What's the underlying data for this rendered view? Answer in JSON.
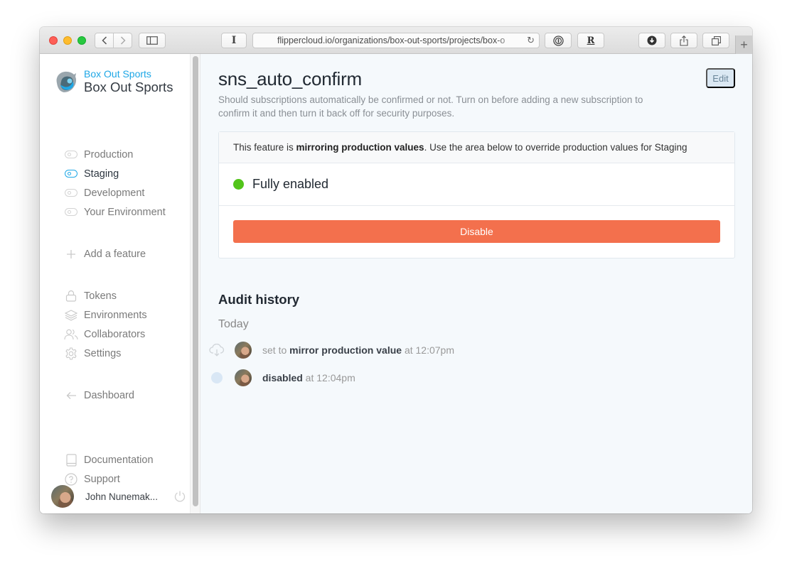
{
  "browser": {
    "url": "flippercloud.io/organizations/box-out-sports/projects/box-o",
    "reader_label": "I",
    "password_label": "①",
    "r_label": "R",
    "new_tab_label": "+"
  },
  "sidebar": {
    "brand": {
      "organization": "Box Out Sports",
      "project": "Box Out Sports"
    },
    "environments": [
      {
        "label": "Production",
        "active": false
      },
      {
        "label": "Staging",
        "active": true
      },
      {
        "label": "Development",
        "active": false
      },
      {
        "label": "Your Environment",
        "active": false
      }
    ],
    "add_feature_label": "Add a feature",
    "admin_items": [
      {
        "label": "Tokens",
        "icon": "lock-icon"
      },
      {
        "label": "Environments",
        "icon": "layers-icon"
      },
      {
        "label": "Collaborators",
        "icon": "users-icon"
      },
      {
        "label": "Settings",
        "icon": "gear-icon"
      }
    ],
    "dashboard_label": "Dashboard",
    "help_items": [
      {
        "label": "Documentation",
        "icon": "book-icon"
      },
      {
        "label": "Support",
        "icon": "help-circle-icon"
      }
    ],
    "user": {
      "name": "John Nunemak..."
    }
  },
  "feature": {
    "name": "sns_auto_confirm",
    "edit_label": "Edit",
    "description": "Should subscriptions automatically be confirmed or not. Turn on before adding a new subscription to confirm it and then turn it back off for security purposes.",
    "notice_prefix": "This feature is ",
    "notice_bold": "mirroring production values",
    "notice_suffix": ". Use the area below to override production values for Staging",
    "status": "Fully enabled",
    "status_color": "#52c41a",
    "disable_label": "Disable",
    "disable_color": "#f3704d"
  },
  "audit": {
    "title": "Audit history",
    "day": "Today",
    "events": [
      {
        "prefix": "set to ",
        "bold": "mirror production value",
        "time": " at 12:07pm",
        "icon": "cloud-download-icon"
      },
      {
        "prefix": "",
        "bold": "disabled",
        "time": " at 12:04pm",
        "icon": "dot-icon"
      }
    ]
  },
  "colors": {
    "accent": "#1ea7e6",
    "main_bg": "#f5f9fc"
  }
}
